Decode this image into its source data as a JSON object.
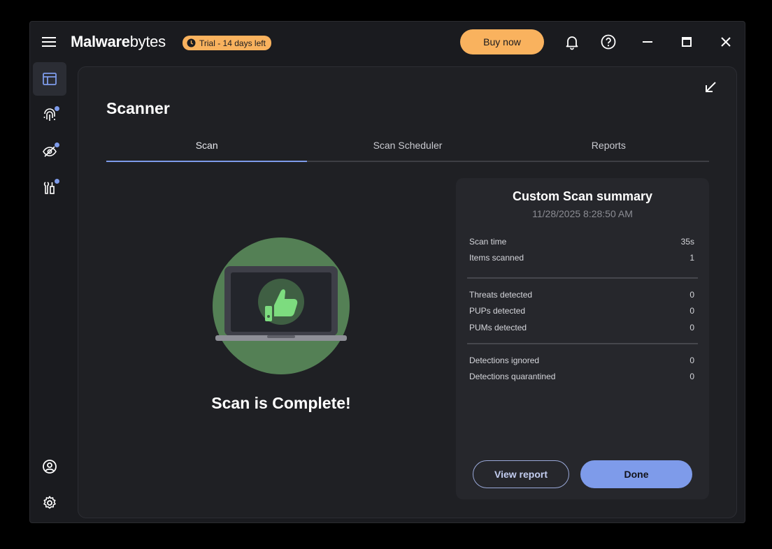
{
  "app": {
    "logo_bold": "Malware",
    "logo_light": "bytes",
    "trial_badge": "Trial - 14 days left",
    "buy_button": "Buy now"
  },
  "sidebar": {
    "items": [
      {
        "icon": "dashboard-icon",
        "active": true
      },
      {
        "icon": "fingerprint-icon",
        "badge": true
      },
      {
        "icon": "eye-slash-icon",
        "badge": true
      },
      {
        "icon": "tools-icon",
        "badge": true
      }
    ],
    "bottom": [
      {
        "icon": "account-icon"
      },
      {
        "icon": "gear-icon"
      }
    ]
  },
  "main": {
    "title": "Scanner",
    "tabs": [
      {
        "label": "Scan",
        "active": true
      },
      {
        "label": "Scan Scheduler",
        "active": false
      },
      {
        "label": "Reports",
        "active": false
      }
    ],
    "status_text": "Scan is Complete!"
  },
  "summary": {
    "title": "Custom Scan summary",
    "date": "11/28/2025 8:28:50 AM",
    "rows": [
      {
        "label": "Scan time",
        "value": "35s"
      },
      {
        "label": "Items scanned",
        "value": "1"
      },
      {
        "label": "Threats detected",
        "value": "0"
      },
      {
        "label": "PUPs detected",
        "value": "0"
      },
      {
        "label": "PUMs detected",
        "value": "0"
      },
      {
        "label": "Detections ignored",
        "value": "0"
      },
      {
        "label": "Detections quarantined",
        "value": "0"
      }
    ],
    "view_report": "View report",
    "done": "Done"
  },
  "colors": {
    "accent": "#7e9bea",
    "brand_orange": "#f9b25e",
    "success_green": "#548055"
  }
}
